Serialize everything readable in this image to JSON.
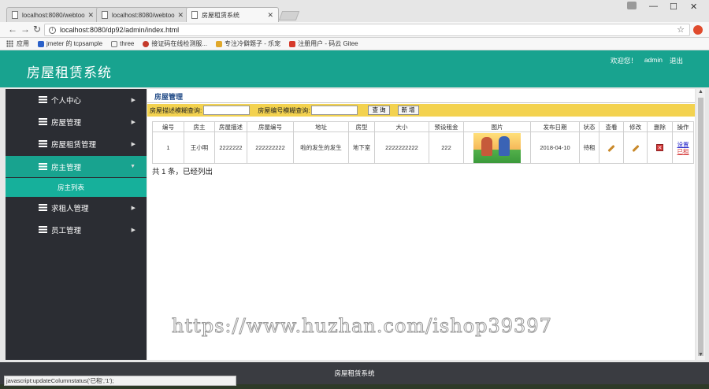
{
  "browser": {
    "tabs": [
      {
        "title": "localhost:8080/webtoo"
      },
      {
        "title": "localhost:8080/webtoo"
      },
      {
        "title": "房屋租赁系统"
      }
    ],
    "url": "localhost:8080/dp92/admin/index.html",
    "bookmarks": [
      {
        "label": "应用",
        "icon": "apps-icon"
      },
      {
        "label": "jmeter 的 tcpsample",
        "icon": "shield-icon",
        "color": "#2b61c9"
      },
      {
        "label": "three",
        "icon": "page-icon",
        "color": "#777777"
      },
      {
        "label": "接证码在线检测服...",
        "icon": "site-icon",
        "color": "#c43a2b"
      },
      {
        "label": "专注冷僻题子 - 乐宠",
        "icon": "site-icon",
        "color": "#e0a82b"
      },
      {
        "label": "注册用户 - 码云 Gitee",
        "icon": "gitee-icon",
        "color": "#d63a2b"
      }
    ]
  },
  "header": {
    "title": "房屋租赁系统",
    "welcome": "欢迎您！",
    "user": "admin",
    "logout": "退出"
  },
  "sidebar": {
    "items": [
      {
        "label": "个人中心"
      },
      {
        "label": "房屋管理"
      },
      {
        "label": "房屋租赁管理"
      },
      {
        "label": "房主管理"
      },
      {
        "label": "求租人管理"
      },
      {
        "label": "员工管理"
      }
    ],
    "submenu": {
      "label": "房主列表"
    }
  },
  "main": {
    "heading": "房屋管理",
    "search": {
      "label1": "房屋描述模糊查询:",
      "label2": "房屋编号模糊查询:",
      "query_btn": "查 询",
      "add_btn": "新 增"
    },
    "table": {
      "headers": [
        "编号",
        "房主",
        "房屋描述",
        "房屋编号",
        "地址",
        "房型",
        "大小",
        "预设租金",
        "图片",
        "发布日期",
        "状态",
        "查看",
        "修改",
        "删除",
        "操作"
      ],
      "rows": [
        {
          "id": "1",
          "owner": "王小明",
          "desc": "2222222",
          "code": "222222222",
          "address": "啦的发生的发生",
          "type": "地下室",
          "size": "2222222222",
          "rent": "222",
          "date": "2018-04-10",
          "status": "待租",
          "op1": "设置",
          "op2": "已租"
        }
      ]
    },
    "summary": "共 1 条，已经列出"
  },
  "watermark": "https://www.huzhan.com/ishop39397",
  "footer": "房屋租赁系统",
  "statusbar": "javascript:updateColumnstatus('已租','1');",
  "colors": {
    "accent": "#18a38f",
    "sidebar": "#2b2d33",
    "search_bar": "#f3d24f",
    "footer": "#3a3c41"
  }
}
